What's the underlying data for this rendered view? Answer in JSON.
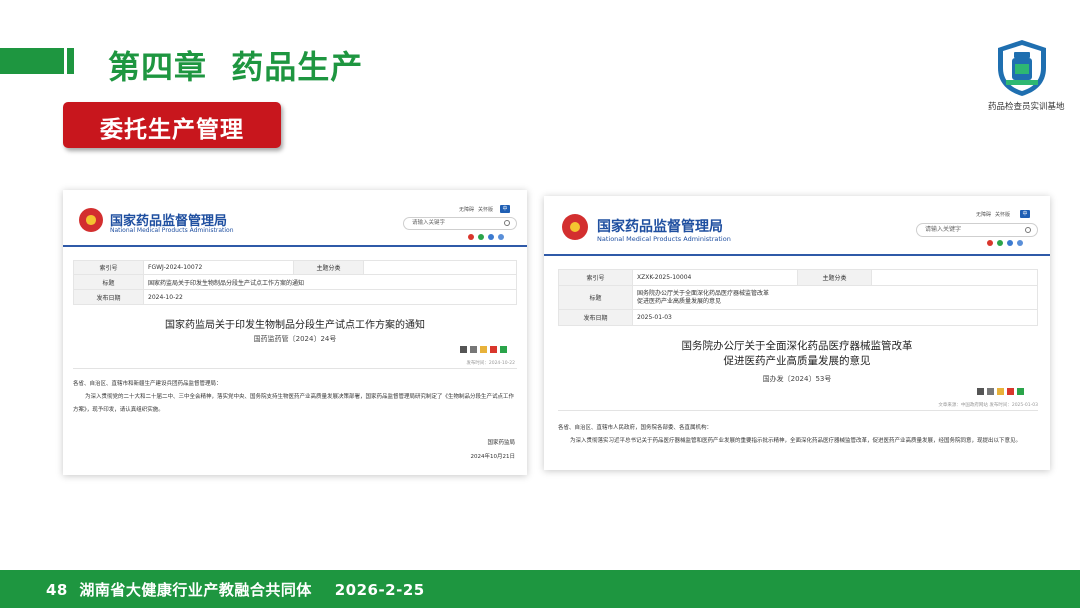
{
  "header": {
    "chapter_title": "第四章  药品生产",
    "section_label": "委托生产管理",
    "logo_text": "药品检查员实训基地"
  },
  "left_page": {
    "site_name": "国家药品监督管理局",
    "site_name_en": "National Medical Products Administration",
    "top_links": [
      "无障碍",
      "关怀版"
    ],
    "search_placeholder": "请输入关键字",
    "meta": {
      "index_label": "索引号",
      "index_value": "FGWJ-2024-10072",
      "topic_label": "主题分类",
      "topic_value": "",
      "title_label": "标题",
      "title_value": "国家药监局关于印发生物制品分段生产试点工作方案的通知",
      "date_label": "发布日期",
      "date_value": "2024-10-22"
    },
    "doc_title": "国家药监局关于印发生物制品分段生产试点工作方案的通知",
    "doc_number": "国药监药管〔2024〕24号",
    "publish_time": "发布时间：2024-10-22",
    "salutation": "各省、自治区、直辖市和新疆生产建设兵团药品监督管理局：",
    "body": "为深入贯彻党的二十大和二十届二中、三中全会精神，落实党中央、国务院支持生物医药产业高质量发展决策部署，国家药品监督管理局研究制定了《生物制品分段生产试点工作方案》，现予印发，请认真组织实施。",
    "signature": "国家药监局",
    "sign_date": "2024年10月21日"
  },
  "right_page": {
    "site_name": "国家药品监督管理局",
    "site_name_en": "National Medical Products Administration",
    "top_links": [
      "无障碍",
      "关怀版"
    ],
    "search_placeholder": "请输入关键字",
    "meta": {
      "index_label": "索引号",
      "index_value": "XZXK-2025-10004",
      "topic_label": "主题分类",
      "topic_value": "",
      "title_label": "标题",
      "title_value_1": "国务院办公厅关于全面深化药品医疗器械监管改革",
      "title_value_2": "促进医药产业高质量发展的意见",
      "date_label": "发布日期",
      "date_value": "2025-01-03"
    },
    "doc_title_1": "国务院办公厅关于全面深化药品医疗器械监管改革",
    "doc_title_2": "促进医药产业高质量发展的意见",
    "doc_number": "国办发〔2024〕53号",
    "source_time": "文章来源：中国政府网站  发布时间：2025-01-03",
    "salutation": "各省、自治区、直辖市人民政府，国务院各部委、各直属机构：",
    "body": "为深入贯彻落实习近平总书记关于药品医疗器械监管和医药产业发展的重要指示批示精神，全面深化药品医疗器械监管改革，促进医药产业高质量发展，经国务院同意，现提出以下意见。"
  },
  "footer": {
    "text": "48  湖南省大健康行业产教融合共同体    2026-2-25"
  },
  "colors": {
    "brand_green": "#1e9640",
    "badge_red": "#c8161d",
    "nmpa_blue": "#1f4fa0"
  }
}
